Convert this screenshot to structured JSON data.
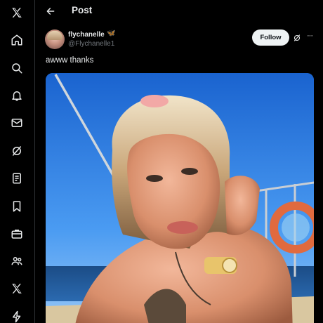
{
  "sidebar": {
    "items": [
      {
        "icon": "x-logo-icon"
      },
      {
        "icon": "home-icon"
      },
      {
        "icon": "search-icon"
      },
      {
        "icon": "notifications-bell-icon"
      },
      {
        "icon": "messages-envelope-icon"
      },
      {
        "icon": "grok-icon"
      },
      {
        "icon": "lists-icon"
      },
      {
        "icon": "bookmark-icon"
      },
      {
        "icon": "jobs-briefcase-icon"
      },
      {
        "icon": "communities-icon"
      },
      {
        "icon": "premium-x-icon"
      },
      {
        "icon": "lightning-bolt-icon"
      }
    ]
  },
  "header": {
    "back_icon": "arrow-left-icon",
    "title": "Post"
  },
  "post": {
    "author": {
      "display_name": "flychanelle",
      "verified_glyph": "🦋",
      "handle": "@Flychanelle1"
    },
    "follow_label": "Follow",
    "text": "awww thanks",
    "more_icon": "more-horizontal-icon"
  },
  "colors": {
    "background": "#000000",
    "text_primary": "#e7e9ea",
    "text_secondary": "#71767b",
    "follow_button_bg": "#eff3f4",
    "divider": "#2f3336"
  }
}
